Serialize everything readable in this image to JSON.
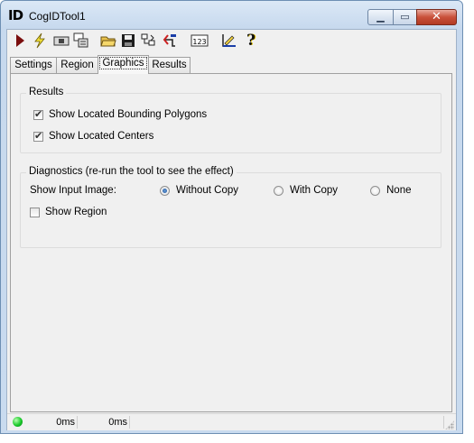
{
  "window": {
    "title": "CogIDTool1",
    "icon_text": "ID",
    "controls": [
      "minimize-icon",
      "maximize-icon",
      "close-icon"
    ]
  },
  "toolbar": {
    "buttons": [
      {
        "name": "run-button",
        "icon": "play-icon"
      },
      {
        "name": "electric-run-button",
        "icon": "lightning-icon"
      },
      {
        "name": "live-display-button",
        "icon": "camera-icon"
      },
      {
        "name": "local-graphics-button",
        "icon": "window-graphics-icon"
      },
      {
        "name": "open-button",
        "icon": "folder-open-icon"
      },
      {
        "name": "save-button",
        "icon": "floppy-disk-icon"
      },
      {
        "name": "tool-tree-button",
        "icon": "tree-icon"
      },
      {
        "name": "reset-button",
        "icon": "reset-arrow-icon"
      },
      {
        "name": "count-button",
        "icon": "counter-icon",
        "text": "123"
      },
      {
        "name": "image-source-button",
        "icon": "ruler-icon"
      },
      {
        "name": "help-button",
        "icon": "help-question-icon",
        "text": "?"
      }
    ]
  },
  "tabs": [
    {
      "label": "Settings",
      "active": false
    },
    {
      "label": "Region",
      "active": false
    },
    {
      "label": "Graphics",
      "active": true
    },
    {
      "label": "Results",
      "active": false
    }
  ],
  "results_group": {
    "legend": "Results",
    "options": [
      {
        "label": "Show Located Bounding Polygons",
        "checked": true
      },
      {
        "label": "Show Located Centers",
        "checked": true
      }
    ]
  },
  "diagnostics_group": {
    "legend": "Diagnostics (re-run the tool to see the effect)",
    "input_image_label": "Show Input Image:",
    "input_image_options": [
      {
        "label": "Without Copy",
        "selected": true
      },
      {
        "label": "With Copy",
        "selected": false
      },
      {
        "label": "None",
        "selected": false
      }
    ],
    "show_region": {
      "label": "Show Region",
      "checked": false
    }
  },
  "statusbar": {
    "status_color": "#19c92a",
    "time1": "0ms",
    "time2": "0ms"
  }
}
